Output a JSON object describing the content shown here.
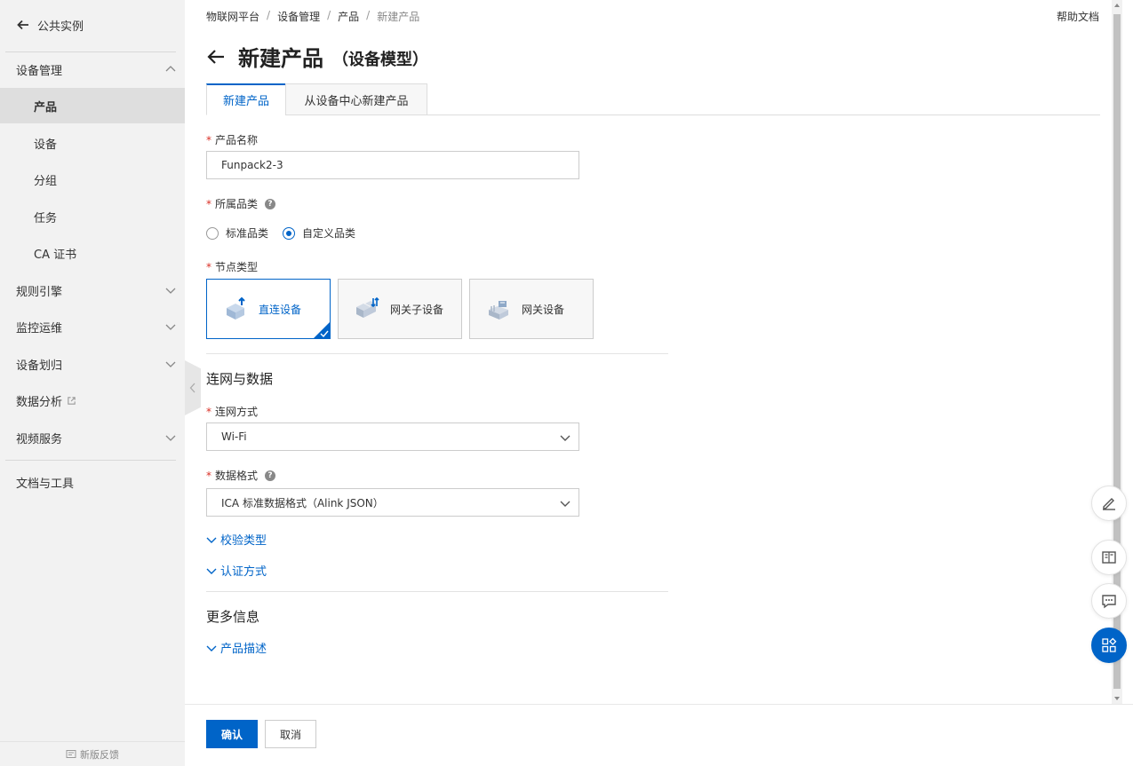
{
  "sidebar": {
    "back_label": "公共实例",
    "items": [
      {
        "label": "设备管理"
      },
      {
        "label": "产品"
      },
      {
        "label": "设备"
      },
      {
        "label": "分组"
      },
      {
        "label": "任务"
      },
      {
        "label": "CA 证书"
      },
      {
        "label": "规则引擎"
      },
      {
        "label": "监控运维"
      },
      {
        "label": "设备划归"
      },
      {
        "label": "数据分析"
      },
      {
        "label": "视频服务"
      },
      {
        "label": "文档与工具"
      }
    ],
    "feedback_label": "新版反馈"
  },
  "breadcrumb": [
    "物联网平台",
    "设备管理",
    "产品",
    "新建产品"
  ],
  "help_link": "帮助文档",
  "page": {
    "title": "新建产品",
    "subtitle": "（设备模型）"
  },
  "tabs": [
    {
      "label": "新建产品",
      "active": true
    },
    {
      "label": "从设备中心新建产品",
      "active": false
    }
  ],
  "form": {
    "product_name_label": "产品名称",
    "product_name_value": "Funpack2-3",
    "category_label": "所属品类",
    "category_options": [
      {
        "label": "标准品类",
        "selected": false
      },
      {
        "label": "自定义品类",
        "selected": true
      }
    ],
    "node_type_label": "节点类型",
    "node_types": [
      {
        "label": "直连设备",
        "selected": true
      },
      {
        "label": "网关子设备",
        "selected": false
      },
      {
        "label": "网关设备",
        "selected": false
      }
    ],
    "connect_section_title": "连网与数据",
    "network_label": "连网方式",
    "network_value": "Wi-Fi",
    "data_format_label": "数据格式",
    "data_format_value": "ICA 标准数据格式（Alink JSON）",
    "verify_type_link": "校验类型",
    "auth_method_link": "认证方式",
    "more_section_title": "更多信息",
    "description_link": "产品描述"
  },
  "footer": {
    "confirm_label": "确认",
    "cancel_label": "取消"
  },
  "float_buttons": [
    "edit-icon",
    "book-icon",
    "chat-icon",
    "apps-icon"
  ],
  "colors": {
    "accent": "#0064c8",
    "required": "#d93026"
  }
}
